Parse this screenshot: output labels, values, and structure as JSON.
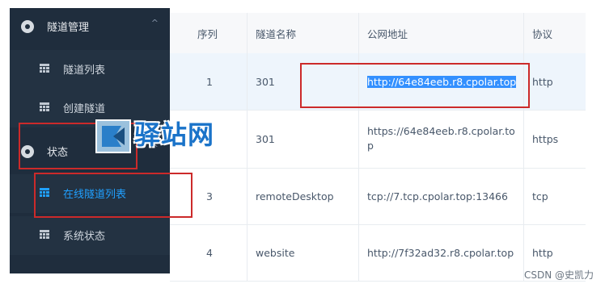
{
  "sidebar": {
    "groups": [
      {
        "label": "隧道管理",
        "chevron": "^"
      },
      {
        "label": "状态",
        "chevron": "^"
      }
    ],
    "items": [
      {
        "label": "隧道列表"
      },
      {
        "label": "创建隧道"
      },
      {
        "label": "在线隧道列表"
      },
      {
        "label": "系统状态"
      }
    ]
  },
  "table": {
    "headers": [
      "序列",
      "隧道名称",
      "公网地址",
      "协议"
    ],
    "rows": [
      {
        "index": "1",
        "name": "301",
        "address": "http://64e84eeb.r8.cpolar.top",
        "protocol": "http"
      },
      {
        "index": "",
        "name": "301",
        "address": "https://64e84eeb.r8.cpolar.to\np",
        "protocol": "https"
      },
      {
        "index": "3",
        "name": "remoteDesktop",
        "address": "tcp://7.tcp.cpolar.top:13466",
        "protocol": "tcp"
      },
      {
        "index": "4",
        "name": "website",
        "address": "http://7f32ad32.r8.cpolar.top",
        "protocol": "http"
      }
    ]
  },
  "watermark": {
    "text": "驿站网"
  },
  "credit": "CSDN @史凯力",
  "colors": {
    "sidebar_bg": "#1f2d3d",
    "active": "#20a0ff",
    "highlight": "#3390ff",
    "annotation": "#cc2a2a"
  }
}
